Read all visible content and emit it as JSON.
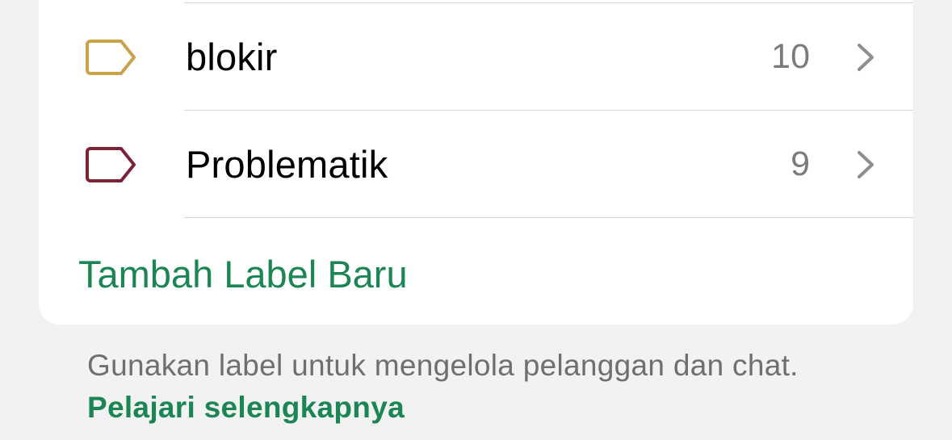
{
  "labels": [
    {
      "name": "blokir",
      "count": "10",
      "color": "#c9a24a",
      "icon": "tag-outline-icon"
    },
    {
      "name": "Problematik",
      "count": "9",
      "color": "#7b2236",
      "icon": "tag-outline-icon"
    }
  ],
  "add_label": "Tambah Label Baru",
  "footer": {
    "description": "Gunakan label untuk mengelola pelanggan dan chat.",
    "link": "Pelajari selengkapnya"
  },
  "colors": {
    "accent": "#1b8654",
    "chevron": "#8e8e93",
    "count": "#7b7b7b",
    "background": "#f2f2f2",
    "card": "#ffffff"
  }
}
